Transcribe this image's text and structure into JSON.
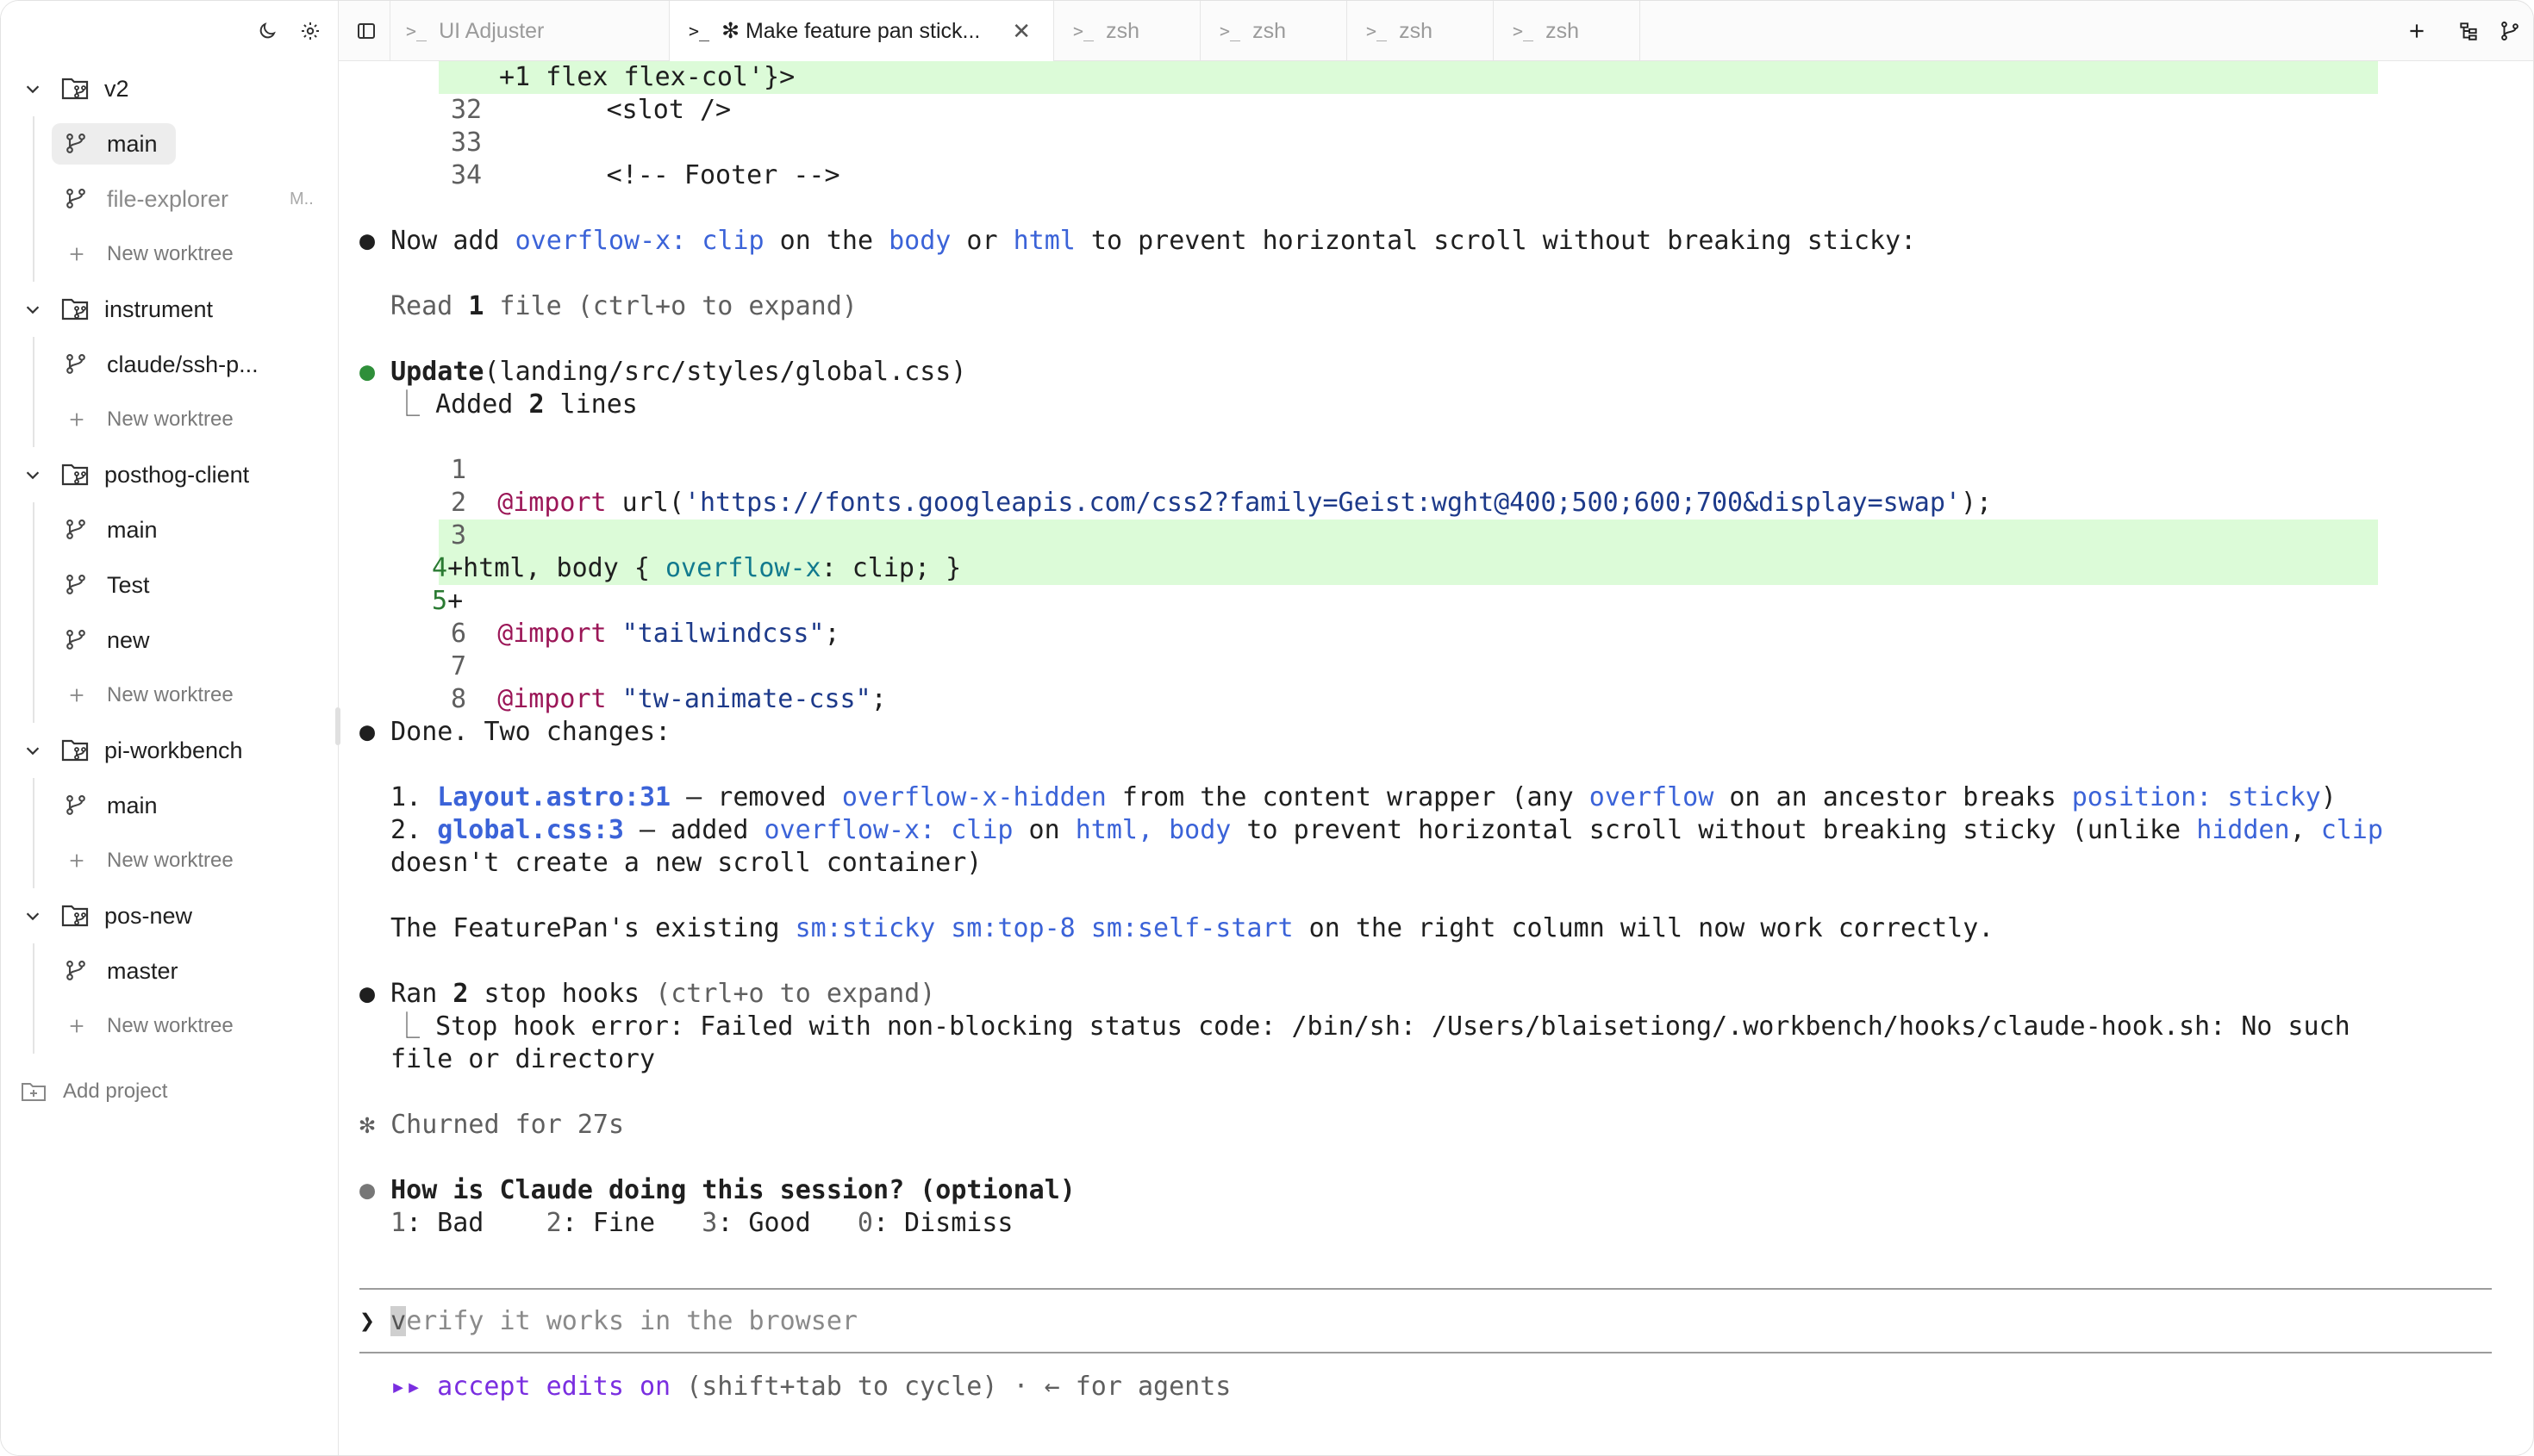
{
  "sidebar": {
    "projects": [
      {
        "name": "v2",
        "worktrees": [
          {
            "name": "main",
            "active": true
          },
          {
            "name": "file-explorer",
            "tag": "M..",
            "dim": true
          }
        ],
        "new_label": "New worktree"
      },
      {
        "name": "instrument",
        "worktrees": [
          {
            "name": "claude/ssh-p..."
          }
        ],
        "new_label": "New worktree"
      },
      {
        "name": "posthog-client",
        "worktrees": [
          {
            "name": "main"
          },
          {
            "name": "Test"
          },
          {
            "name": "new"
          }
        ],
        "new_label": "New worktree"
      },
      {
        "name": "pi-workbench",
        "worktrees": [
          {
            "name": "main"
          }
        ],
        "new_label": "New worktree"
      },
      {
        "name": "pos-new",
        "worktrees": [
          {
            "name": "master"
          }
        ],
        "new_label": "New worktree"
      }
    ],
    "add_project": "Add project"
  },
  "tabs": [
    {
      "label": "UI Adjuster",
      "active": false
    },
    {
      "label": "✻ Make feature pan stick...",
      "active": true,
      "close": "✕"
    },
    {
      "label": "zsh",
      "active": false
    },
    {
      "label": "zsh",
      "active": false
    },
    {
      "label": "zsh",
      "active": false
    },
    {
      "label": "zsh",
      "active": false
    }
  ],
  "terminal": {
    "top_diff": {
      "l0": "+1 flex flex-col'}>",
      "l32": [
        "32",
        "        <slot />"
      ],
      "l33": [
        "33",
        ""
      ],
      "l34": [
        "34",
        "        <!-- Footer -->"
      ]
    },
    "now_add": {
      "pre": " Now add ",
      "a": "overflow-x: clip",
      "b": " on the ",
      "c": "body",
      "d": " or ",
      "e": "html",
      "f": " to prevent horizontal scroll without breaking sticky:"
    },
    "read": {
      "pre": "Read ",
      "n": "1",
      "post": " file (ctrl+o to expand)"
    },
    "update": {
      "verb": "Update",
      "path": "(landing/src/styles/global.css)"
    },
    "added": {
      "pre": "Added ",
      "n": "2",
      "post": " lines"
    },
    "diff": [
      {
        "n": "1",
        "code": ""
      },
      {
        "n": "2",
        "kw": "@import",
        "mid": " url(",
        "str": "'https://fonts.googleapis.com/css2?family=Geist:wght@400;500;600;700&display=swap'",
        "tail": ");"
      },
      {
        "n": "3",
        "code": ""
      },
      {
        "n": "4",
        "add": "+html, body { ",
        "teal": "overflow-x",
        "tail": ": clip; }"
      },
      {
        "n": "5",
        "add": "+"
      },
      {
        "n": "6",
        "kw": "@import",
        "mid": " ",
        "str": "\"tailwindcss\"",
        "tail": ";"
      },
      {
        "n": "7",
        "code": ""
      },
      {
        "n": "8",
        "kw": "@import",
        "mid": " ",
        "str": "\"tw-animate-css\"",
        "tail": ";"
      }
    ],
    "done": " Done. Two changes:",
    "item1": {
      "num": "1. ",
      "file": "Layout.astro:31",
      "a": " — removed ",
      "b": "overflow-x-hidden",
      "c": " from the content wrapper (any ",
      "d": "overflow",
      "e": " on an ancestor breaks ",
      "f": "position: sticky",
      "g": ")"
    },
    "item2": {
      "num": "2. ",
      "file": "global.css:3",
      "a": " — added ",
      "b": "overflow-x: clip",
      "c": " on ",
      "d": "html, body",
      "e": " to prevent horizontal scroll without breaking sticky (unlike ",
      "f": "hidden",
      "g": ", ",
      "h": "clip",
      "cont": "doesn't create a new scroll container)"
    },
    "featurepan": {
      "a": "The FeaturePan's existing ",
      "b": "sm:sticky sm:top-8 sm:self-start",
      "c": " on the right column will now work correctly."
    },
    "ran": {
      "pre": " Ran ",
      "n": "2",
      "post": " stop hooks ",
      "hint": "(ctrl+o to expand)"
    },
    "stop1": "Stop hook error: Failed with non-blocking status code: /bin/sh: /Users/blaisetiong/.workbench/hooks/claude-hook.sh: No such",
    "stop2": "file or directory",
    "churned": "✻ Churned for 27s",
    "question": " How is Claude doing this session? (optional)",
    "rating": {
      "k1": "1",
      "v1": ": Bad",
      "k2": "2",
      "v2": ": Fine",
      "k3": "3",
      "v3": ": Good",
      "k0": "0",
      "v0": ": Dismiss"
    },
    "prompt_char": "❯",
    "input_first": "v",
    "input_rest": "erify it works in the browser",
    "status": {
      "arrows": "▸▸",
      "mode": " accept edits on",
      "rest": " (shift+tab to cycle) · ← for agents"
    }
  },
  "colors": {
    "diff_add": "#dcfbd8",
    "link": "#3b63d8",
    "keyword": "#9b1657",
    "accept": "#7a2ee0"
  }
}
